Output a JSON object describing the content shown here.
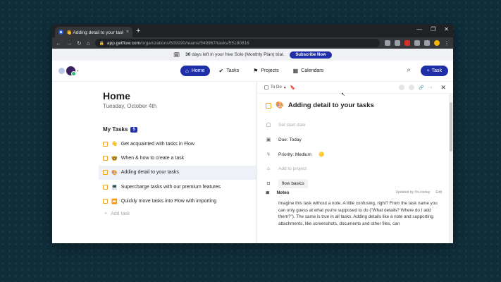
{
  "browser": {
    "tab_title": "👋 Adding detail to your tasks",
    "tab_close": "×",
    "new_tab": "+",
    "window_controls": [
      "—",
      "❐",
      "✕"
    ],
    "url_host": "app.getflow.com",
    "url_path": "/organizations/509190/teams/549967/tasks/55180816"
  },
  "banner": {
    "text_bold": "30",
    "text": "days left in your free Solo (Monthly Plan) trial.",
    "button": "Subscribe Now"
  },
  "nav": {
    "items": [
      {
        "label": "Home",
        "icon": "home-icon",
        "active": true
      },
      {
        "label": "Tasks",
        "icon": "check-icon",
        "active": false
      },
      {
        "label": "Projects",
        "icon": "flag-icon",
        "active": false
      },
      {
        "label": "Calendars",
        "icon": "calendar-icon",
        "active": false
      }
    ],
    "task_button": "Task",
    "accent": "#1f2fa8"
  },
  "home": {
    "title": "Home",
    "date": "Tuesday, October 4th",
    "mytasks_label": "My Tasks",
    "mytasks_count": "5",
    "tasks": [
      {
        "emoji": "👋",
        "label": "Get acquainted with tasks in Flow"
      },
      {
        "emoji": "🤓",
        "label": "When & how to create a task"
      },
      {
        "emoji": "🎨",
        "label": "Adding detail to your tasks"
      },
      {
        "emoji": "💻",
        "label": "Supercharge tasks with our premium features"
      },
      {
        "emoji": "⏩",
        "label": "Quickly move tasks into Flow with importing"
      }
    ],
    "add_task": "Add task"
  },
  "panel": {
    "status": "To Do",
    "title_emoji": "🎨",
    "title": "Adding detail to your tasks",
    "start_date": "Set start date",
    "due": "Due: Today",
    "priority": "Priority: Medium",
    "priority_emoji": "🟡",
    "project": "Add to project",
    "tag": "flow basics",
    "notes_label": "Notes",
    "notes_meta": "Updated by You today",
    "notes_edit": "Edit",
    "notes_body": "Imagine this task without a note. A little confusing, right? From the task name you can only guess at what you're supposed to do (\"What details? Where do I add them?\"). The same is true in all tasks. Adding details like a note and supporting attachments, like screenshots, documents and other files, can"
  }
}
